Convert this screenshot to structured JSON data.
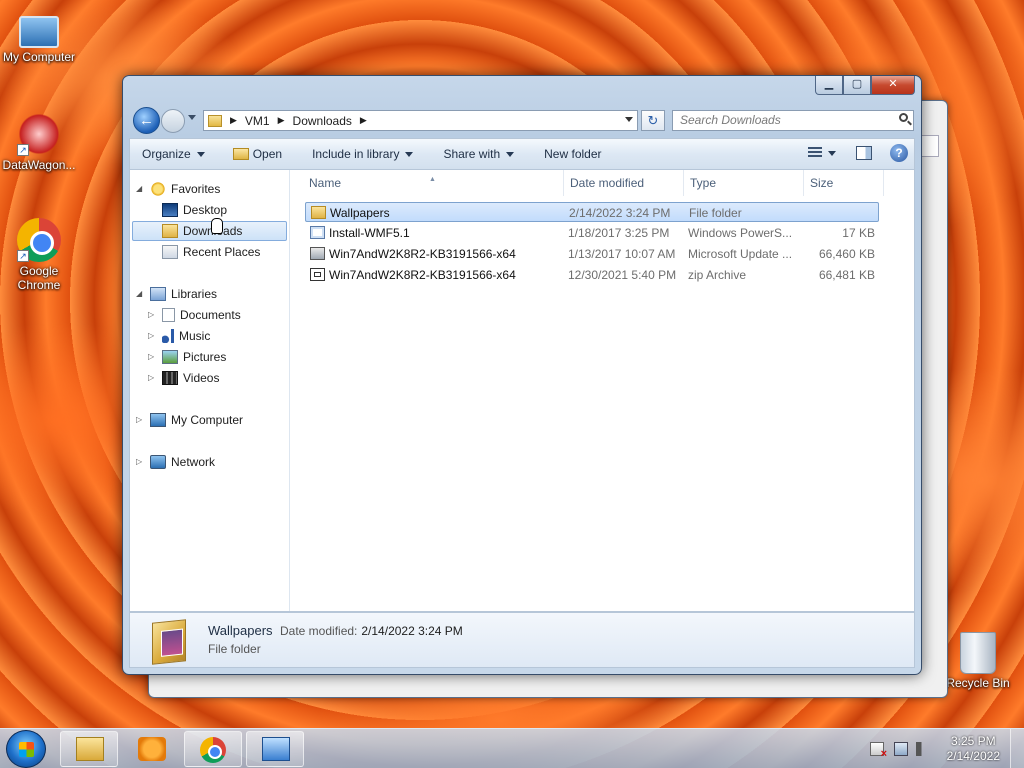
{
  "desktop": {
    "icons": [
      {
        "label": "My Computer",
        "icon": "my-computer-icon"
      },
      {
        "label": "DataWagon...",
        "icon": "datawagon-icon"
      },
      {
        "label": "Google\nChrome",
        "icon": "chrome-icon"
      },
      {
        "label": "Recycle Bin",
        "icon": "recycle-bin-icon"
      }
    ]
  },
  "window": {
    "buttons": {
      "minimize": "▁",
      "maximize": "▢",
      "close": "✕"
    },
    "breadcrumbs": [
      "VM1",
      "Downloads"
    ],
    "search_placeholder": "Search Downloads",
    "toolbar": {
      "organize": "Organize",
      "open": "Open",
      "include_in_library": "Include in library",
      "share_with": "Share with",
      "new_folder": "New folder"
    },
    "nav_tree": {
      "favorites": "Favorites",
      "desktop": "Desktop",
      "downloads": "Downloads",
      "recent_places": "Recent Places",
      "libraries": "Libraries",
      "documents": "Documents",
      "music": "Music",
      "pictures": "Pictures",
      "videos": "Videos",
      "my_computer": "My Computer",
      "network": "Network"
    },
    "columns": {
      "name": "Name",
      "date_modified": "Date modified",
      "type": "Type",
      "size": "Size"
    },
    "files": [
      {
        "name": "Wallpapers",
        "date": "2/14/2022 3:24 PM",
        "type": "File folder",
        "size": "",
        "icon": "folder-icon",
        "selected": true
      },
      {
        "name": "Install-WMF5.1",
        "date": "1/18/2017 3:25 PM",
        "type": "Windows PowerS...",
        "size": "17 KB",
        "icon": "powershell-script-icon",
        "selected": false
      },
      {
        "name": "Win7AndW2K8R2-KB3191566-x64",
        "date": "1/13/2017 10:07 AM",
        "type": "Microsoft Update ...",
        "size": "66,460 KB",
        "icon": "update-package-icon",
        "selected": false
      },
      {
        "name": "Win7AndW2K8R2-KB3191566-x64",
        "date": "12/30/2021 5:40 PM",
        "type": "zip Archive",
        "size": "66,481 KB",
        "icon": "zip-archive-icon",
        "selected": false
      }
    ],
    "details": {
      "name": "Wallpapers",
      "date_label": "Date modified:",
      "date_value": "2/14/2022 3:24 PM",
      "type": "File folder"
    }
  },
  "taskbar": {
    "apps": [
      "windows-explorer-icon",
      "media-player-icon",
      "chrome-icon",
      "control-panel-icon"
    ],
    "clock": {
      "time": "3:25 PM",
      "date": "2/14/2022"
    }
  }
}
